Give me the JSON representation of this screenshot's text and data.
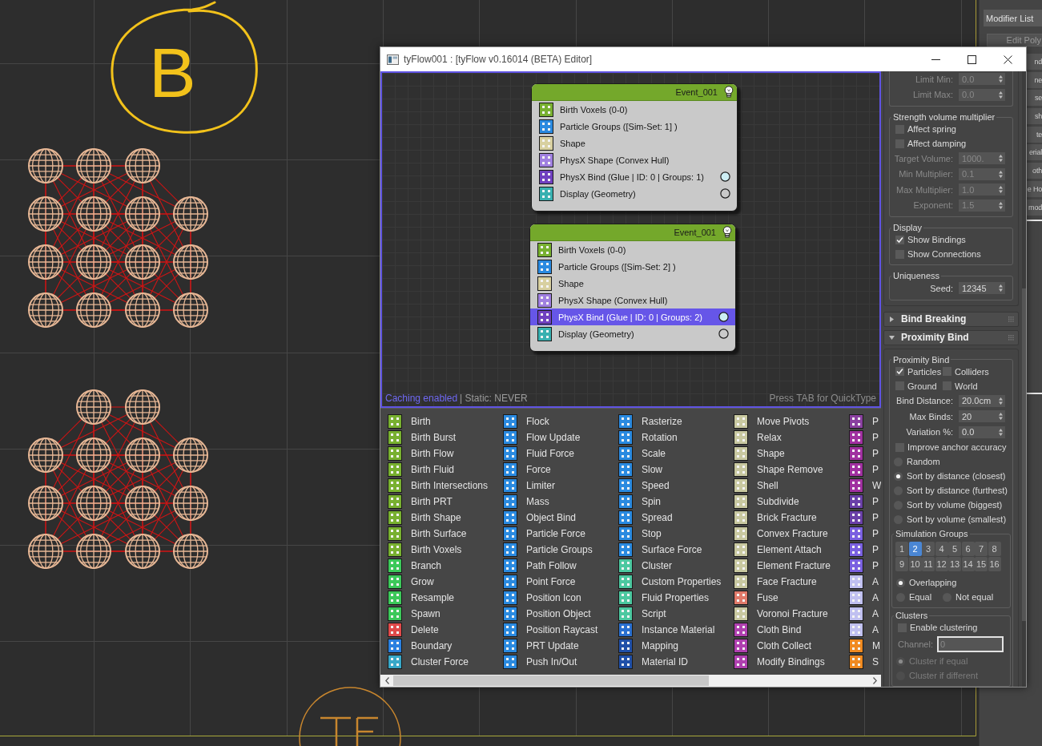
{
  "viewport": {
    "annotation": "B"
  },
  "command_panel": {
    "dropdown": "Modifier List",
    "button": "Edit Poly",
    "stack": [
      {
        "label": "nd"
      },
      {
        "label": "ne"
      },
      {
        "label": "se"
      },
      {
        "label": "sh"
      },
      {
        "label": "te"
      },
      {
        "label": "erial"
      },
      {
        "label": "oth"
      },
      {
        "label": "e Ho"
      },
      {
        "label": "mod"
      }
    ]
  },
  "editor": {
    "title": "tyFlow001 : [tyFlow v0.16014 (BETA) Editor]",
    "events": [
      {
        "title": "Event_001",
        "operators": [
          {
            "label": "Birth Voxels (0-0)",
            "color": "#78b030",
            "selected": false
          },
          {
            "label": "Particle Groups ([Sim-Set: 1] )",
            "color": "#2a8ae0",
            "selected": false
          },
          {
            "label": "Shape",
            "color": "#d8d0a0",
            "selected": false
          },
          {
            "label": "PhysX Shape (Convex Hull)",
            "color": "#a080e0",
            "selected": false
          },
          {
            "label": "PhysX Bind (Glue | ID: 0 | Groups: 1)",
            "color": "#7040c0",
            "selected": false,
            "socket": {
              "filled": true
            }
          },
          {
            "label": "Display (Geometry)",
            "color": "#38b0b0",
            "selected": false,
            "socket": {
              "filled": false
            }
          }
        ]
      },
      {
        "title": "Event_001",
        "operators": [
          {
            "label": "Birth Voxels (0-0)",
            "color": "#78b030",
            "selected": false
          },
          {
            "label": "Particle Groups ([Sim-Set: 2] )",
            "color": "#2a8ae0",
            "selected": false
          },
          {
            "label": "Shape",
            "color": "#d8d0a0",
            "selected": false
          },
          {
            "label": "PhysX Shape (Convex Hull)",
            "color": "#a080e0",
            "selected": false
          },
          {
            "label": "PhysX Bind (Glue | ID: 0 | Groups: 2)",
            "color": "#7040c0",
            "selected": true,
            "socket": {
              "filled": true
            }
          },
          {
            "label": "Display (Geometry)",
            "color": "#38b0b0",
            "selected": false,
            "socket": {
              "filled": false
            }
          }
        ]
      }
    ],
    "status": {
      "caching": "Caching enabled",
      "static": "| Static: NEVER",
      "hint": "Press TAB for QuickType"
    },
    "operator_columns": [
      {
        "items": [
          {
            "label": "Birth",
            "color": "#78b030"
          },
          {
            "label": "Birth Burst",
            "color": "#78b030"
          },
          {
            "label": "Birth Flow",
            "color": "#78b030"
          },
          {
            "label": "Birth Fluid",
            "color": "#78b030"
          },
          {
            "label": "Birth Intersections",
            "color": "#78b030"
          },
          {
            "label": "Birth PRT",
            "color": "#78b030"
          },
          {
            "label": "Birth Shape",
            "color": "#78b030"
          },
          {
            "label": "Birth Surface",
            "color": "#78b030"
          },
          {
            "label": "Birth Voxels",
            "color": "#78b030"
          },
          {
            "label": "Branch",
            "color": "#3cc85a"
          },
          {
            "label": "Grow",
            "color": "#3cc85a"
          },
          {
            "label": "Resample",
            "color": "#3cc85a"
          },
          {
            "label": "Spawn",
            "color": "#3cc85a"
          },
          {
            "label": "Delete",
            "color": "#e04a4a"
          },
          {
            "label": "Boundary",
            "color": "#2a80e0"
          },
          {
            "label": "Cluster Force",
            "color": "#38a8c8"
          }
        ]
      },
      {
        "items": [
          {
            "label": "Flock",
            "color": "#2a8ae0"
          },
          {
            "label": "Flow Update",
            "color": "#2a8ae0"
          },
          {
            "label": "Fluid Force",
            "color": "#2a8ae0"
          },
          {
            "label": "Force",
            "color": "#2a8ae0"
          },
          {
            "label": "Limiter",
            "color": "#2a8ae0"
          },
          {
            "label": "Mass",
            "color": "#2a8ae0"
          },
          {
            "label": "Object Bind",
            "color": "#2a8ae0"
          },
          {
            "label": "Particle Force",
            "color": "#2a8ae0"
          },
          {
            "label": "Particle Groups",
            "color": "#2a8ae0"
          },
          {
            "label": "Path Follow",
            "color": "#2a8ae0"
          },
          {
            "label": "Point Force",
            "color": "#2a8ae0"
          },
          {
            "label": "Position Icon",
            "color": "#2a8ae0"
          },
          {
            "label": "Position Object",
            "color": "#2a8ae0"
          },
          {
            "label": "Position Raycast",
            "color": "#2a8ae0"
          },
          {
            "label": "PRT Update",
            "color": "#2a8ae0"
          },
          {
            "label": "Push In/Out",
            "color": "#2a8ae0"
          }
        ]
      },
      {
        "items": [
          {
            "label": "Rasterize",
            "color": "#2a8ae0"
          },
          {
            "label": "Rotation",
            "color": "#2a8ae0"
          },
          {
            "label": "Scale",
            "color": "#2a8ae0"
          },
          {
            "label": "Slow",
            "color": "#2a8ae0"
          },
          {
            "label": "Speed",
            "color": "#2a8ae0"
          },
          {
            "label": "Spin",
            "color": "#2a8ae0"
          },
          {
            "label": "Spread",
            "color": "#2a8ae0"
          },
          {
            "label": "Stop",
            "color": "#2a8ae0"
          },
          {
            "label": "Surface Force",
            "color": "#2a8ae0"
          },
          {
            "label": "Cluster",
            "color": "#4cc8a0"
          },
          {
            "label": "Custom Properties",
            "color": "#4cc8a0"
          },
          {
            "label": "Fluid Properties",
            "color": "#4cc8a0"
          },
          {
            "label": "Script",
            "color": "#4cc8a0"
          },
          {
            "label": "Instance Material",
            "color": "#2a70d0"
          },
          {
            "label": "Mapping",
            "color": "#2050a8"
          },
          {
            "label": "Material ID",
            "color": "#2050a8"
          }
        ]
      },
      {
        "items": [
          {
            "label": "Move Pivots",
            "color": "#c8c8a0"
          },
          {
            "label": "Relax",
            "color": "#c8c8a0"
          },
          {
            "label": "Shape",
            "color": "#c8c8a0"
          },
          {
            "label": "Shape Remove",
            "color": "#c8c8a0"
          },
          {
            "label": "Shell",
            "color": "#c8c8a0"
          },
          {
            "label": "Subdivide",
            "color": "#c8c8a0"
          },
          {
            "label": "Brick Fracture",
            "color": "#c8c8a0"
          },
          {
            "label": "Convex Fracture",
            "color": "#c8c8a0"
          },
          {
            "label": "Element Attach",
            "color": "#c8c8a0"
          },
          {
            "label": "Element Fracture",
            "color": "#c8c8a0"
          },
          {
            "label": "Face Fracture",
            "color": "#c8c8a0"
          },
          {
            "label": "Fuse",
            "color": "#e07a6a"
          },
          {
            "label": "Voronoi Fracture",
            "color": "#c8c8a0"
          },
          {
            "label": "Cloth Bind",
            "color": "#b040b0"
          },
          {
            "label": "Cloth Collect",
            "color": "#b040b0"
          },
          {
            "label": "Modify Bindings",
            "color": "#b040b0"
          }
        ]
      },
      {
        "items": [
          {
            "label": "P",
            "color": "#8a40a0"
          },
          {
            "label": "P",
            "color": "#a030a0"
          },
          {
            "label": "P",
            "color": "#a030a0"
          },
          {
            "label": "P",
            "color": "#a030a0"
          },
          {
            "label": "W",
            "color": "#a030a0"
          },
          {
            "label": "P",
            "color": "#6a40a8"
          },
          {
            "label": "P",
            "color": "#6a40a8"
          },
          {
            "label": "P",
            "color": "#7a60e0"
          },
          {
            "label": "P",
            "color": "#7a60e0"
          },
          {
            "label": "P",
            "color": "#7a60e0"
          },
          {
            "label": "A",
            "color": "#c0c0f0"
          },
          {
            "label": "A",
            "color": "#c0c0f0"
          },
          {
            "label": "A",
            "color": "#c0c0f0"
          },
          {
            "label": "A",
            "color": "#c0c0f0"
          },
          {
            "label": "M",
            "color": "#f08a20"
          },
          {
            "label": "S",
            "color": "#f08a20"
          }
        ]
      }
    ],
    "rollout": {
      "sections": [
        {
          "expanded": true,
          "groups": [
            {
              "rows": [
                {
                  "kind": "spinner",
                  "label": "Limit Min:",
                  "value": "0.0",
                  "disabled": true
                },
                {
                  "kind": "spinner",
                  "label": "Limit Max:",
                  "value": "0.0",
                  "disabled": true
                }
              ]
            },
            {
              "title": "Strength volume multiplier",
              "rows": [
                {
                  "kind": "checkbox",
                  "label": "Affect spring",
                  "checked": false
                },
                {
                  "kind": "checkbox",
                  "label": "Affect damping",
                  "checked": false
                },
                {
                  "kind": "spinner",
                  "label": "Target Volume:",
                  "value": "1000.",
                  "disabled": true
                },
                {
                  "kind": "spinner",
                  "label": "Min Multiplier:",
                  "value": "0.1",
                  "disabled": true
                },
                {
                  "kind": "spinner",
                  "label": "Max Multiplier:",
                  "value": "1.0",
                  "disabled": true
                },
                {
                  "kind": "spinner",
                  "label": "Exponent:",
                  "value": "1.5",
                  "disabled": true
                }
              ]
            },
            {
              "title": "Display",
              "rows": [
                {
                  "kind": "checkbox",
                  "label": "Show Bindings",
                  "checked": true
                },
                {
                  "kind": "checkbox",
                  "label": "Show Connections",
                  "checked": false
                }
              ]
            },
            {
              "title": "Uniqueness",
              "rows": [
                {
                  "kind": "spinner",
                  "label": "Seed:",
                  "value": "12345",
                  "disabled": false
                }
              ]
            }
          ]
        },
        {
          "title": "Bind Breaking",
          "expanded": false
        },
        {
          "title": "Proximity Bind",
          "expanded": true,
          "groups": [
            {
              "title": "Proximity Bind",
              "rows": [
                {
                  "kind": "checkbox_pair",
                  "items": [
                    {
                      "label": "Particles",
                      "checked": true
                    },
                    {
                      "label": "Colliders",
                      "checked": false
                    }
                  ]
                },
                {
                  "kind": "checkbox_pair",
                  "items": [
                    {
                      "label": "Ground",
                      "checked": false
                    },
                    {
                      "label": "World",
                      "checked": false
                    }
                  ]
                },
                {
                  "kind": "spinner",
                  "label": "Bind Distance:",
                  "value": "20.0cm",
                  "disabled": false
                },
                {
                  "kind": "spinner",
                  "label": "Max Binds:",
                  "value": "20",
                  "disabled": false
                },
                {
                  "kind": "spinner",
                  "label": "Variation %:",
                  "value": "0.0",
                  "disabled": false
                },
                {
                  "kind": "checkbox",
                  "label": "Improve anchor accuracy",
                  "checked": false
                },
                {
                  "kind": "radio",
                  "label": "Random",
                  "selected": false,
                  "disabled": false
                },
                {
                  "kind": "radio",
                  "label": "Sort by distance (closest)",
                  "selected": true,
                  "disabled": false
                },
                {
                  "kind": "radio",
                  "label": "Sort by distance (furthest)",
                  "selected": false,
                  "disabled": false
                },
                {
                  "kind": "radio",
                  "label": "Sort by volume (biggest)",
                  "selected": false,
                  "disabled": false
                },
                {
                  "kind": "radio",
                  "label": "Sort by volume (smallest)",
                  "selected": false,
                  "disabled": false
                },
                {
                  "kind": "group",
                  "title": "Simulation Groups",
                  "rows": [
                    {
                      "kind": "toggles",
                      "items": [
                        {
                          "label": "1",
                          "selected": false
                        },
                        {
                          "label": "2",
                          "selected": true
                        },
                        {
                          "label": "3",
                          "selected": false
                        },
                        {
                          "label": "4",
                          "selected": false
                        },
                        {
                          "label": "5",
                          "selected": false
                        },
                        {
                          "label": "6",
                          "selected": false
                        },
                        {
                          "label": "7",
                          "selected": false
                        },
                        {
                          "label": "8",
                          "selected": false
                        },
                        {
                          "label": "9",
                          "selected": false
                        },
                        {
                          "label": "10",
                          "selected": false
                        },
                        {
                          "label": "11",
                          "selected": false
                        },
                        {
                          "label": "12",
                          "selected": false
                        },
                        {
                          "label": "13",
                          "selected": false
                        },
                        {
                          "label": "14",
                          "selected": false
                        },
                        {
                          "label": "15",
                          "selected": false
                        },
                        {
                          "label": "16",
                          "selected": false
                        }
                      ]
                    },
                    {
                      "kind": "radio",
                      "label": "Overlapping",
                      "selected": true,
                      "disabled": false
                    },
                    {
                      "kind": "radio_pair",
                      "items": [
                        {
                          "label": "Equal",
                          "selected": false,
                          "disabled": false
                        },
                        {
                          "label": "Not equal",
                          "selected": false,
                          "disabled": false
                        }
                      ]
                    }
                  ]
                },
                {
                  "kind": "group",
                  "title": "Clusters",
                  "rows": [
                    {
                      "kind": "checkbox",
                      "label": "Enable clustering",
                      "checked": false
                    },
                    {
                      "kind": "text_field",
                      "label": "Channel:",
                      "value": "0",
                      "disabled": true
                    },
                    {
                      "kind": "radio",
                      "label": "Cluster if equal",
                      "selected": true,
                      "disabled": true
                    },
                    {
                      "kind": "radio",
                      "label": "Cluster if different",
                      "selected": false,
                      "disabled": true
                    }
                  ]
                }
              ]
            }
          ]
        }
      ]
    }
  }
}
